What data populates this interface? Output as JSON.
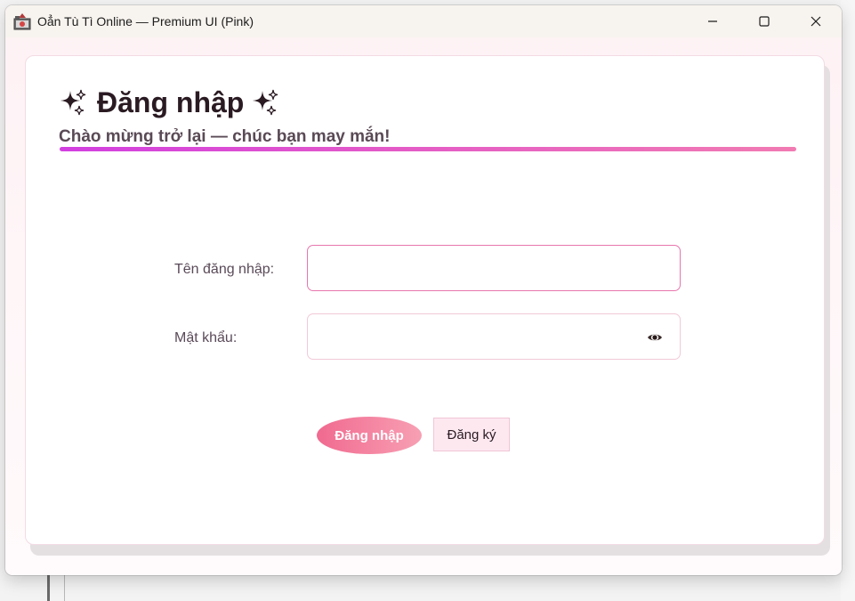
{
  "window": {
    "title": "Oẳn Tù Tì Online — Premium UI (Pink)"
  },
  "controls": {
    "minimize": "minimize-icon",
    "maximize": "maximize-icon",
    "close": "close-icon"
  },
  "header": {
    "title": "Đăng nhập",
    "subtitle": "Chào mừng trở lại — chúc bạn may mắn!",
    "icon": "sparkle-icon"
  },
  "form": {
    "username_label": "Tên đăng nhập:",
    "username_value": "",
    "password_label": "Mật khẩu:",
    "password_value": "",
    "password_toggle_icon": "eye-icon"
  },
  "actions": {
    "login_label": "Đăng nhập",
    "register_label": "Đăng ký"
  },
  "colors": {
    "accent_start": "#d23fe0",
    "accent_end": "#f17bb2",
    "login_button": "#f06a8f",
    "register_button": "#fde8f0",
    "focused_input_border": "#e776ad"
  }
}
